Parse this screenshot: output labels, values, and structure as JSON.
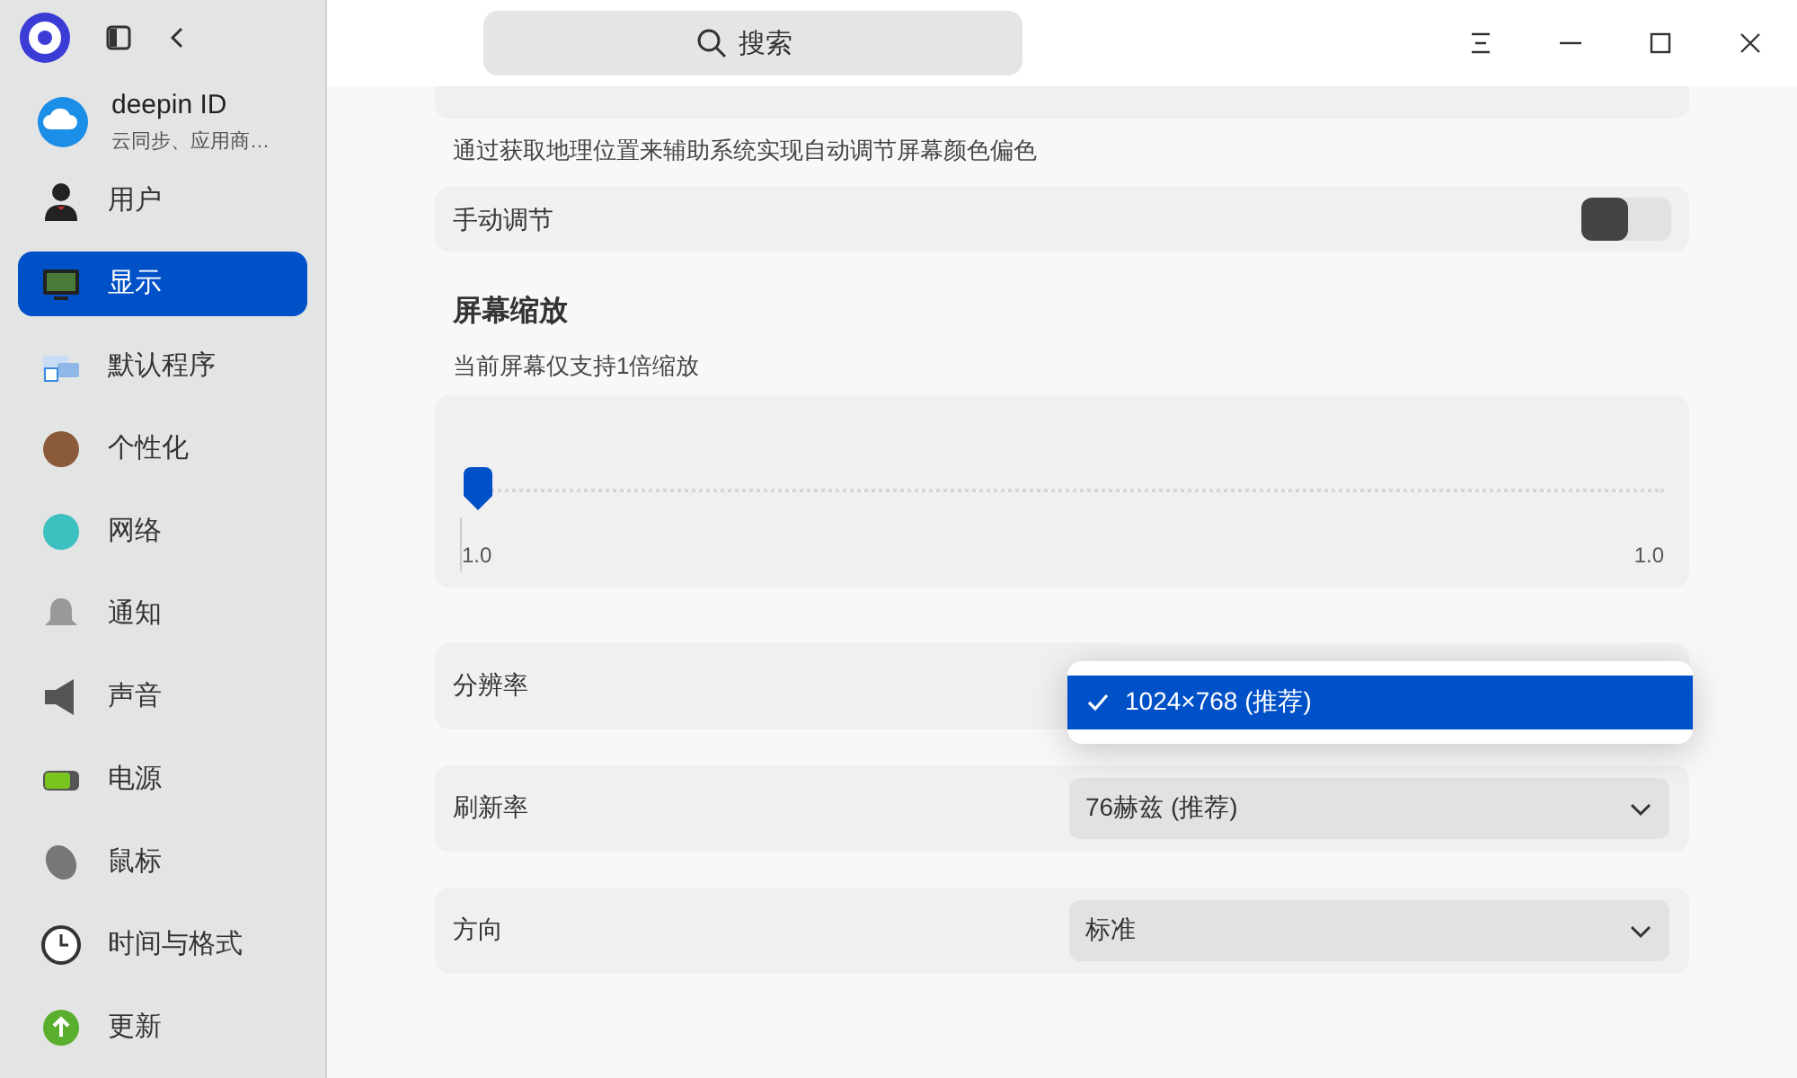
{
  "search": {
    "placeholder": "搜索"
  },
  "account": {
    "name": "deepin ID",
    "subtitle": "云同步、应用商…"
  },
  "sidebar": {
    "items": [
      {
        "label": "用户",
        "selected": false
      },
      {
        "label": "显示",
        "selected": true
      },
      {
        "label": "默认程序",
        "selected": false
      },
      {
        "label": "个性化",
        "selected": false
      },
      {
        "label": "网络",
        "selected": false
      },
      {
        "label": "通知",
        "selected": false
      },
      {
        "label": "声音",
        "selected": false
      },
      {
        "label": "电源",
        "selected": false
      },
      {
        "label": "鼠标",
        "selected": false
      },
      {
        "label": "时间与格式",
        "selected": false
      },
      {
        "label": "更新",
        "selected": false
      }
    ]
  },
  "color_temp": {
    "description": "通过获取地理位置来辅助系统实现自动调节屏幕颜色偏色",
    "manual": {
      "label": "手动调节",
      "on": false
    }
  },
  "scaling": {
    "title": "屏幕缩放",
    "subtitle": "当前屏幕仅支持1倍缩放",
    "level": 0,
    "min_label": "1.0",
    "max_label": "1.0"
  },
  "resolution": {
    "label": "分辨率",
    "options": [
      {
        "label": "1024×768 (推荐)",
        "selected": true
      }
    ]
  },
  "refresh_rate": {
    "label": "刷新率",
    "value": "76赫兹 (推荐)"
  },
  "orientation": {
    "label": "方向",
    "value": "标准"
  }
}
